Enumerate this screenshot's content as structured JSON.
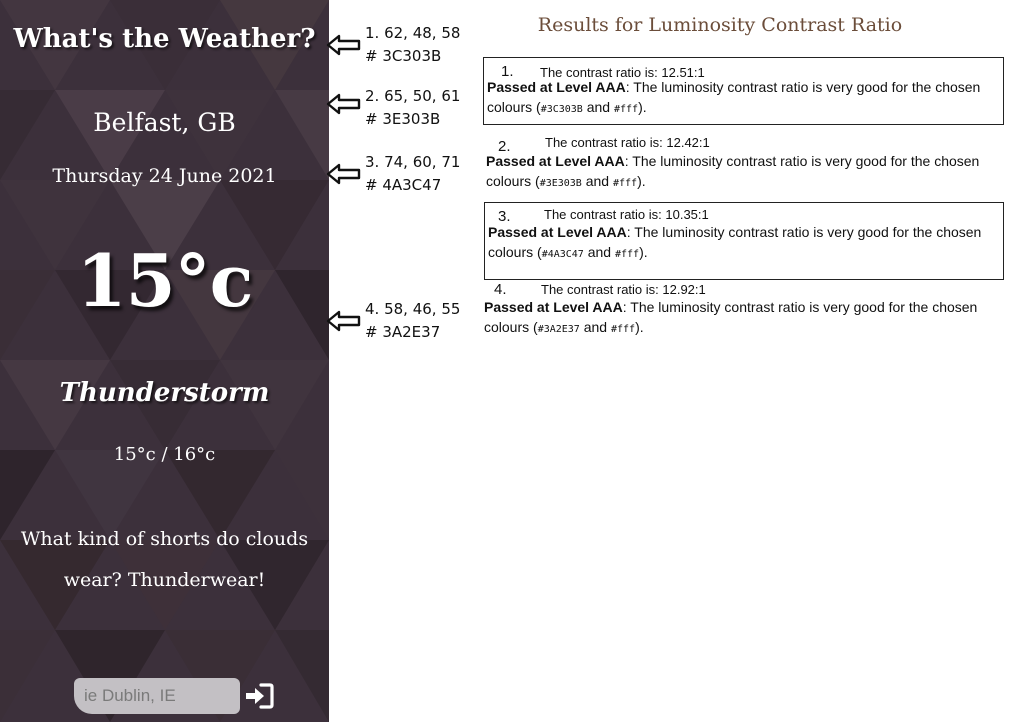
{
  "app": {
    "title": "What's the Weather?",
    "city": "Belfast, GB",
    "date": "Thursday 24 June 2021",
    "temperature": "15°c",
    "condition": "Thunderstorm",
    "range": "15°c / 16°c",
    "joke": "What kind of shorts do clouds wear? Thunderwear!",
    "search_placeholder": "ie Dublin, IE",
    "submit_icon": "sign-in-icon",
    "bg_color": "#3c303b"
  },
  "annotations": [
    {
      "rgb": "1. 62, 48, 58",
      "hex": "# 3C303B"
    },
    {
      "rgb": "2. 65, 50, 61",
      "hex": "# 3E303B"
    },
    {
      "rgb": "3. 74, 60, 71",
      "hex": "# 4A3C47"
    },
    {
      "rgb": "4. 58, 46, 55",
      "hex": "# 3A2E37"
    }
  ],
  "results_title": "Results for Luminosity Contrast Ratio",
  "results": [
    {
      "num": "1.",
      "ratio": "The contrast ratio is: 12.51:1",
      "level": "Passed at Level AAA",
      "text": ": The luminosity contrast ratio is very good for the chosen colours (",
      "fg": "#3C303B",
      "and": " and ",
      "bg": "#fff",
      "end": ")."
    },
    {
      "num": "2.",
      "ratio": "The contrast ratio is: 12.42:1",
      "level": "Passed at Level AAA",
      "text": ": The luminosity contrast ratio is very good for the chosen colours (",
      "fg": "#3E303B",
      "and": " and ",
      "bg": "#fff",
      "end": ")."
    },
    {
      "num": "3.",
      "ratio": "The contrast ratio is: 10.35:1",
      "level": "Passed at Level AAA",
      "text": ": The luminosity contrast ratio is very good for the chosen colours (",
      "fg": "#4A3C47",
      "and": " and ",
      "bg": "#fff",
      "end": ")."
    },
    {
      "num": "4.",
      "ratio": "The contrast ratio is: 12.92:1",
      "level": "Passed at Level AAA",
      "text": ": The luminosity contrast ratio is very good for the chosen colours (",
      "fg": "#3A2E37",
      "and": " and ",
      "bg": "#fff",
      "end": ")."
    }
  ]
}
